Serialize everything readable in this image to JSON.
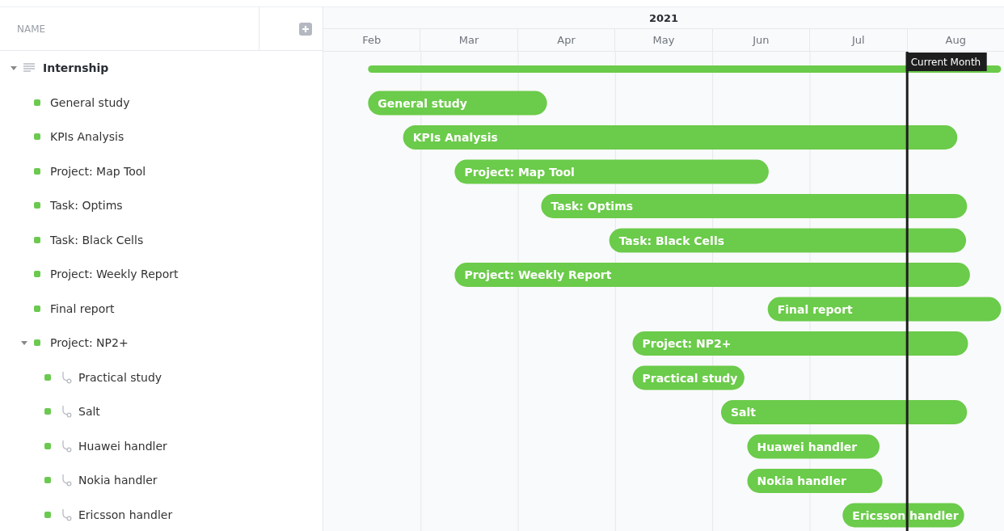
{
  "name_header": "NAME",
  "timeline": {
    "year": "2021",
    "months": [
      "Feb",
      "Mar",
      "Apr",
      "May",
      "Jun",
      "Jul",
      "Aug"
    ],
    "current_marker": {
      "label": "Current Month"
    }
  },
  "tasks": [
    {
      "name": "Internship",
      "expanded": true,
      "children": [
        {
          "name": "General study",
          "bar_label": "General study"
        },
        {
          "name": "KPIs Analysis",
          "bar_label": "KPIs Analysis"
        },
        {
          "name": "Project: Map Tool",
          "bar_label": "Project: Map Tool"
        },
        {
          "name": "Task: Optims",
          "bar_label": "Task: Optims"
        },
        {
          "name": "Task: Black Cells",
          "bar_label": "Task: Black Cells"
        },
        {
          "name": "Project: Weekly Report",
          "bar_label": "Project: Weekly Report"
        },
        {
          "name": "Final report",
          "bar_label": "Final report"
        },
        {
          "name": "Project: NP2+",
          "bar_label": "Project: NP2+",
          "expanded": true,
          "children": [
            {
              "name": "Practical study",
              "bar_label": "Practical study"
            },
            {
              "name": "Salt",
              "bar_label": "Salt"
            },
            {
              "name": "Huawei handler",
              "bar_label": "Huawei handler"
            },
            {
              "name": "Nokia handler",
              "bar_label": "Nokia handler"
            },
            {
              "name": "Ericsson handler",
              "bar_label": "Ericsson handler"
            }
          ]
        }
      ]
    }
  ]
}
